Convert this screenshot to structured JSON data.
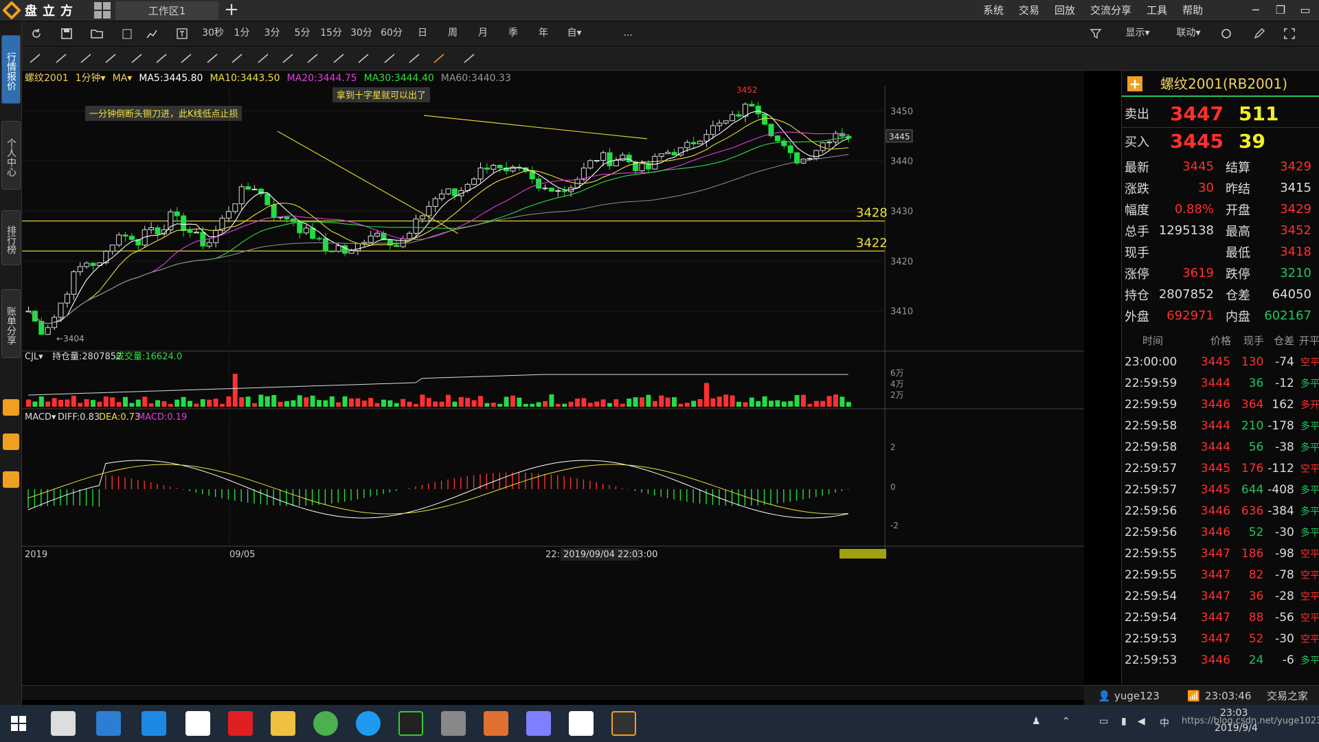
{
  "titlebar": {
    "logo": "盘立方",
    "workspace_tab": "工作区1",
    "add_tab": "+",
    "menus": [
      "系统",
      "交易",
      "回放",
      "交流分享",
      "工具",
      "帮助"
    ],
    "win_buttons": [
      "─",
      "❐",
      "▭",
      "✕"
    ]
  },
  "toolbar1": {
    "periods": [
      "30秒",
      "1分",
      "3分",
      "5分",
      "15分",
      "30分",
      "60分",
      "日",
      "周",
      "月",
      "季",
      "年",
      "自▾",
      "..."
    ],
    "right": [
      "显示▾",
      "联动▾"
    ]
  },
  "sidebar": {
    "tabs": [
      "行情报价",
      "个人中心",
      "排行榜",
      "账单分享"
    ]
  },
  "chart_header": {
    "symbol": "螺纹2001",
    "period": "1分钟▾",
    "ma_label": "MA▾",
    "ma5": "MA5:3445.80",
    "ma10": "MA10:3443.50",
    "ma20": "MA20:3444.75",
    "ma30": "MA30:3444.40",
    "ma60": "MA60:3440.33"
  },
  "vol_header": {
    "name": "CJL▾",
    "hold": "持仓量:2807852",
    "vol": "成交量:16624.0"
  },
  "macd_header": {
    "name": "MACD▾",
    "diff": "DIFF:0.83",
    "dea": "DEA:0.73",
    "macd": "MACD:0.19"
  },
  "annotations": {
    "a1": "一分钟倒断头铡刀进，此K线低点止损",
    "a2": "拿到十字星就可以出了",
    "high": "3452",
    "low": "3404",
    "line1": "3428",
    "line2": "3422",
    "cur": "3445"
  },
  "price_axis": [
    "3450",
    "3440",
    "3430",
    "3420",
    "3410"
  ],
  "vol_axis": [
    "6万",
    "4万",
    "2万"
  ],
  "macd_axis": [
    "2",
    "0",
    "-2"
  ],
  "time_axis": {
    "left": "2019",
    "mid": "09/05",
    "cursor_prefix": "22:",
    "cursor": "2019/09/04 22:03:00"
  },
  "right_panel": {
    "title": "螺纹2001(RB2001)",
    "ask": {
      "label": "卖出",
      "price": "3447",
      "vol": "511"
    },
    "bid": {
      "label": "买入",
      "price": "3445",
      "vol": "39"
    },
    "stats": [
      {
        "k": "最新",
        "v": "3445",
        "vc": "#ff3030",
        "k2": "结算",
        "v2": "3429",
        "v2c": "#ff3030"
      },
      {
        "k": "涨跌",
        "v": "30",
        "vc": "#ff3030",
        "k2": "昨结",
        "v2": "3415",
        "v2c": "#ddd"
      },
      {
        "k": "幅度",
        "v": "0.88%",
        "vc": "#ff3030",
        "k2": "开盘",
        "v2": "3429",
        "v2c": "#ff3030"
      },
      {
        "k": "总手",
        "v": "1295138",
        "vc": "#ddd",
        "k2": "最高",
        "v2": "3452",
        "v2c": "#ff3030"
      },
      {
        "k": "现手",
        "v": "",
        "vc": "#ddd",
        "k2": "最低",
        "v2": "3418",
        "v2c": "#ff3030"
      },
      {
        "k": "涨停",
        "v": "3619",
        "vc": "#ff3030",
        "k2": "跌停",
        "v2": "3210",
        "v2c": "#22c55e"
      },
      {
        "k": "持仓",
        "v": "2807852",
        "vc": "#ddd",
        "k2": "仓差",
        "v2": "64050",
        "v2c": "#ddd"
      },
      {
        "k": "外盘",
        "v": "692971",
        "vc": "#ff3030",
        "k2": "内盘",
        "v2": "602167",
        "v2c": "#22c55e"
      }
    ],
    "ticks_header": [
      "时间",
      "价格",
      "现手",
      "仓差",
      "开平"
    ],
    "ticks": [
      {
        "t": "23:00:00",
        "p": "3445",
        "h": "130",
        "hc": "#ff3030",
        "c": "-74",
        "o": "空平",
        "oc": "#ff3030"
      },
      {
        "t": "22:59:59",
        "p": "3444",
        "h": "36",
        "hc": "#22c55e",
        "c": "-12",
        "o": "多平",
        "oc": "#22c55e"
      },
      {
        "t": "22:59:59",
        "p": "3446",
        "h": "364",
        "hc": "#ff3030",
        "c": "162",
        "o": "多开",
        "oc": "#ff3030"
      },
      {
        "t": "22:59:58",
        "p": "3444",
        "h": "210",
        "hc": "#22c55e",
        "c": "-178",
        "o": "多平",
        "oc": "#22c55e"
      },
      {
        "t": "22:59:58",
        "p": "3444",
        "h": "56",
        "hc": "#22c55e",
        "c": "-38",
        "o": "多平",
        "oc": "#22c55e"
      },
      {
        "t": "22:59:57",
        "p": "3445",
        "h": "176",
        "hc": "#ff3030",
        "c": "-112",
        "o": "空平",
        "oc": "#ff3030"
      },
      {
        "t": "22:59:57",
        "p": "3445",
        "h": "644",
        "hc": "#22c55e",
        "c": "-408",
        "o": "多平",
        "oc": "#22c55e"
      },
      {
        "t": "22:59:56",
        "p": "3446",
        "h": "636",
        "hc": "#ff3030",
        "c": "-384",
        "o": "多平",
        "oc": "#22c55e"
      },
      {
        "t": "22:59:56",
        "p": "3446",
        "h": "52",
        "hc": "#22c55e",
        "c": "-30",
        "o": "多平",
        "oc": "#22c55e"
      },
      {
        "t": "22:59:55",
        "p": "3447",
        "h": "186",
        "hc": "#ff3030",
        "c": "-98",
        "o": "空平",
        "oc": "#ff3030"
      },
      {
        "t": "22:59:55",
        "p": "3447",
        "h": "82",
        "hc": "#ff3030",
        "c": "-78",
        "o": "空平",
        "oc": "#ff3030"
      },
      {
        "t": "22:59:54",
        "p": "3447",
        "h": "36",
        "hc": "#ff3030",
        "c": "-28",
        "o": "空平",
        "oc": "#ff3030"
      },
      {
        "t": "22:59:54",
        "p": "3447",
        "h": "88",
        "hc": "#ff3030",
        "c": "-56",
        "o": "空平",
        "oc": "#ff3030"
      },
      {
        "t": "22:59:53",
        "p": "3447",
        "h": "52",
        "hc": "#ff3030",
        "c": "-30",
        "o": "空平",
        "oc": "#ff3030"
      },
      {
        "t": "22:59:53",
        "p": "3446",
        "h": "24",
        "hc": "#22c55e",
        "c": "-6",
        "o": "多平",
        "oc": "#22c55e"
      }
    ]
  },
  "userbar": {
    "user": "yuge123",
    "time": "23:03:46",
    "brand": "交易之家"
  },
  "taskbar": {
    "time": "23:03",
    "date": "2019/9/4",
    "ime": "中",
    "watermark": "https://blog.csdn.net/yuge1023"
  }
}
